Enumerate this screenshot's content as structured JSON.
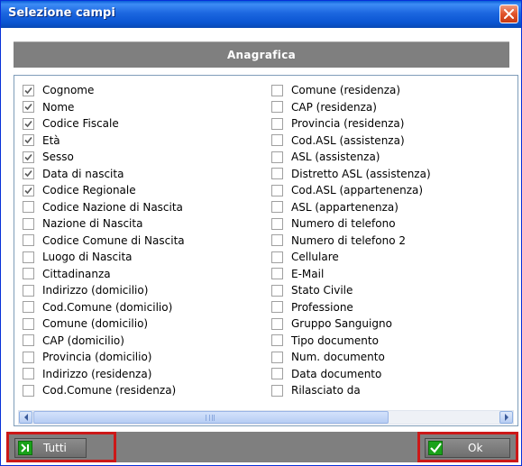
{
  "window": {
    "title": "Selezione campi"
  },
  "section": {
    "header": "Anagrafica"
  },
  "fields_left": [
    {
      "label": "Cognome",
      "checked": true
    },
    {
      "label": "Nome",
      "checked": true
    },
    {
      "label": "Codice Fiscale",
      "checked": true
    },
    {
      "label": "Età",
      "checked": true
    },
    {
      "label": "Sesso",
      "checked": true
    },
    {
      "label": "Data di nascita",
      "checked": true
    },
    {
      "label": "Codice Regionale",
      "checked": true
    },
    {
      "label": "Codice Nazione di Nascita",
      "checked": false
    },
    {
      "label": "Nazione di Nascita",
      "checked": false
    },
    {
      "label": "Codice Comune di Nascita",
      "checked": false
    },
    {
      "label": "Luogo di Nascita",
      "checked": false
    },
    {
      "label": "Cittadinanza",
      "checked": false
    },
    {
      "label": "Indirizzo (domicilio)",
      "checked": false
    },
    {
      "label": "Cod.Comune (domicilio)",
      "checked": false
    },
    {
      "label": "Comune (domicilio)",
      "checked": false
    },
    {
      "label": "CAP (domicilio)",
      "checked": false
    },
    {
      "label": "Provincia (domicilio)",
      "checked": false
    },
    {
      "label": "Indirizzo (residenza)",
      "checked": false
    },
    {
      "label": "Cod.Comune (residenza)",
      "checked": false
    }
  ],
  "fields_right": [
    {
      "label": "Comune (residenza)",
      "checked": false
    },
    {
      "label": "CAP (residenza)",
      "checked": false
    },
    {
      "label": "Provincia (residenza)",
      "checked": false
    },
    {
      "label": "Cod.ASL (assistenza)",
      "checked": false
    },
    {
      "label": "ASL (assistenza)",
      "checked": false
    },
    {
      "label": "Distretto ASL (assistenza)",
      "checked": false
    },
    {
      "label": "Cod.ASL (appartenenza)",
      "checked": false
    },
    {
      "label": "ASL (appartenenza)",
      "checked": false
    },
    {
      "label": "Numero di telefono",
      "checked": false
    },
    {
      "label": "Numero di telefono 2",
      "checked": false
    },
    {
      "label": "Cellulare",
      "checked": false
    },
    {
      "label": "E-Mail",
      "checked": false
    },
    {
      "label": "Stato Civile",
      "checked": false
    },
    {
      "label": "Professione",
      "checked": false
    },
    {
      "label": "Gruppo Sanguigno",
      "checked": false
    },
    {
      "label": "Tipo documento",
      "checked": false
    },
    {
      "label": "Num. documento",
      "checked": false
    },
    {
      "label": "Data documento",
      "checked": false
    },
    {
      "label": "Rilasciato da",
      "checked": false
    }
  ],
  "footer": {
    "tutti_label": "Tutti",
    "ok_label": "Ok"
  },
  "icons": {
    "close": "close-icon",
    "tutti": "select-all-icon",
    "ok": "checkmark-icon",
    "scroll_left": "arrow-left-icon",
    "scroll_right": "arrow-right-icon"
  },
  "colors": {
    "titlebar": "#1c67e0",
    "header_bg": "#7f7f7f",
    "footer_bg": "#7f7f7f",
    "highlight": "#cc1818",
    "button_icon": "#1aa21a"
  }
}
